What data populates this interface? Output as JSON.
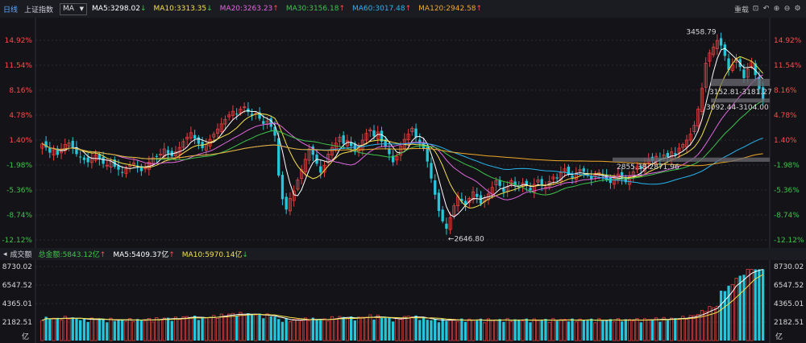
{
  "header": {
    "tabs": [
      "日线",
      "上证指数"
    ],
    "selected_indicator": "MA",
    "ma_readouts": [
      {
        "label": "MA5:3298.02",
        "arrow": "↓",
        "color": "#ffffff"
      },
      {
        "label": "MA10:3313.35",
        "arrow": "↓",
        "color": "#f5e04a"
      },
      {
        "label": "MA20:3263.23",
        "arrow": "↑",
        "color": "#e066e0"
      },
      {
        "label": "MA30:3156.18",
        "arrow": "↑",
        "color": "#3ec34a"
      },
      {
        "label": "MA60:3017.48",
        "arrow": "↑",
        "color": "#26b5f0"
      },
      {
        "label": "MA120:2942.58",
        "arrow": "↑",
        "color": "#f0a82a"
      }
    ],
    "restore_label": "重载",
    "controls": [
      "restore-icon",
      "back-icon",
      "zoom-in-icon",
      "zoom-out-icon",
      "settings-icon"
    ]
  },
  "volume_header": {
    "title": "成交额",
    "items": [
      {
        "label": "总金额:5843.12亿",
        "arrow": "↑",
        "color": "#3ec34a"
      },
      {
        "label": "MA5:5409.37亿",
        "arrow": "↑",
        "color": "#ffffff"
      },
      {
        "label": "MA10:5970.14亿",
        "arrow": "↓",
        "color": "#f5e04a"
      }
    ]
  },
  "colors": {
    "up": "#e04040",
    "down": "#26c6da",
    "pos": "#ff4a4a",
    "neg": "#3ec34a",
    "neutral": "#d8d8d8"
  },
  "chart_data": [
    {
      "type": "candlestick",
      "y_axis_ticks": [
        "14.92%",
        "11.54%",
        "8.16%",
        "4.78%",
        "1.40%",
        "-1.98%",
        "-5.36%",
        "-8.74%",
        "-12.12%"
      ],
      "ylim_percent": [
        -12.12,
        14.92
      ],
      "annotations": [
        "3458.79",
        "2646.80",
        "3152.81-3181.27",
        "3092.44-3104.00",
        "2855.38-2871.96"
      ],
      "series_ma": [
        "MA5",
        "MA10",
        "MA20",
        "MA30",
        "MA60",
        "MA120"
      ],
      "close_percent_approx": [
        0.9,
        0.4,
        -0.3,
        0.1,
        -0.6,
        0.2,
        0.8,
        1.0,
        0.3,
        -0.5,
        -0.9,
        -1.3,
        -1.6,
        -1.0,
        -0.6,
        -1.2,
        -1.8,
        -2.0,
        -1.5,
        -2.2,
        -2.6,
        -3.0,
        -2.5,
        -2.0,
        -1.7,
        -2.2,
        -2.8,
        -2.4,
        -1.6,
        -1.0,
        -0.8,
        -0.5,
        0.2,
        -0.4,
        -0.8,
        -0.2,
        0.4,
        1.2,
        1.8,
        2.4,
        1.6,
        0.9,
        0.3,
        0.8,
        1.5,
        2.2,
        2.9,
        3.6,
        4.2,
        4.8,
        5.3,
        4.9,
        5.6,
        5.9,
        5.2,
        4.7,
        5.0,
        4.3,
        3.6,
        4.0,
        3.2,
        2.0,
        -3.4,
        -6.6,
        -8.0,
        -6.5,
        -5.5,
        -4.0,
        -2.6,
        -1.2,
        0.2,
        -0.6,
        -1.8,
        -3.0,
        -2.0,
        -0.5,
        0.4,
        1.0,
        1.8,
        0.9,
        1.3,
        0.6,
        -0.2,
        0.4,
        1.4,
        2.3,
        2.8,
        1.9,
        2.5,
        1.2,
        0.5,
        -0.5,
        -1.6,
        -0.8,
        0.6,
        1.5,
        2.2,
        3.0,
        1.8,
        1.0,
        0.2,
        -1.5,
        -3.8,
        -6.0,
        -8.2,
        -9.6,
        -10.6,
        -9.1,
        -7.5,
        -6.2,
        -6.9,
        -7.4,
        -6.5,
        -5.6,
        -6.3,
        -7.2,
        -6.4,
        -5.9,
        -5.0,
        -4.1,
        -4.8,
        -5.6,
        -4.9,
        -4.1,
        -4.7,
        -5.1,
        -4.4,
        -4.8,
        -5.4,
        -4.6,
        -4.0,
        -4.8,
        -5.0,
        -4.2,
        -3.6,
        -3.8,
        -3.0,
        -2.5,
        -3.2,
        -3.7,
        -3.1,
        -2.6,
        -2.9,
        -3.4,
        -3.9,
        -3.3,
        -3.0,
        -3.4,
        -4.0,
        -4.4,
        -3.7,
        -3.2,
        -3.8,
        -4.3,
        -3.5,
        -2.9,
        -2.2,
        -2.5,
        -1.8,
        -1.2,
        -1.4,
        -0.8,
        -1.3,
        -0.6,
        -0.9,
        -0.2,
        -0.6,
        0.3,
        0.8,
        1.4,
        2.2,
        3.4,
        5.6,
        8.4,
        11.8,
        13.2,
        14.0,
        14.9,
        14.2,
        12.8,
        10.9,
        11.6,
        12.4,
        11.3,
        9.8,
        11.0,
        12.0,
        10.2,
        8.3,
        6.8
      ],
      "start_value": 2900
    },
    {
      "type": "bar",
      "y_axis_ticks": [
        "8730.02",
        "6547.52",
        "4365.01",
        "2182.51"
      ],
      "unit": "亿",
      "ylim": [
        0,
        8730.02
      ]
    }
  ]
}
